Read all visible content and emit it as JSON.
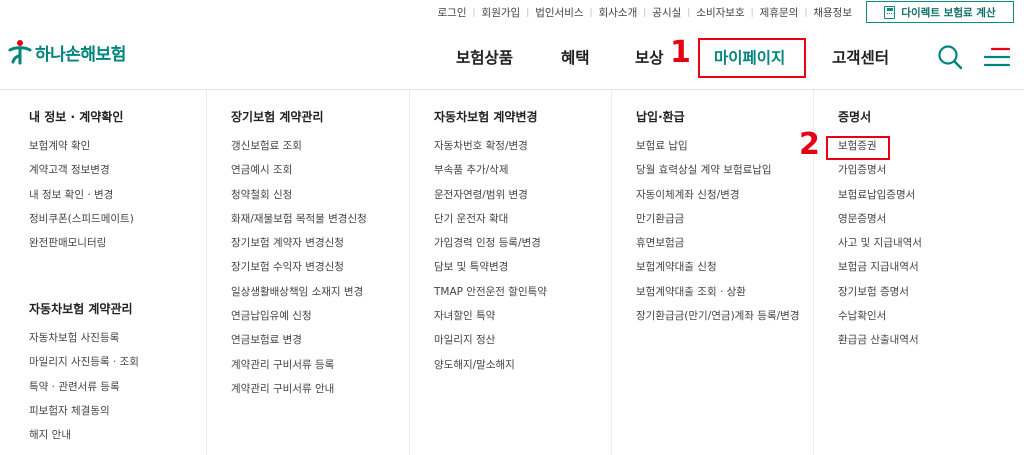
{
  "utility": {
    "links": [
      "로그인",
      "회원가입",
      "법인서비스",
      "회사소개",
      "공시실",
      "소비자보호",
      "제휴문의",
      "채용정보"
    ],
    "calc_button": "다이렉트 보험료 계산"
  },
  "brand": {
    "name": "하나손해보험",
    "color": "#00857b"
  },
  "gnb": {
    "items": [
      "보험상품",
      "혜택",
      "보상",
      "마이페이지",
      "고객센터"
    ],
    "active": "마이페이지"
  },
  "annotations": {
    "marker_1": "1",
    "marker_2": "2"
  },
  "menu": {
    "col1": {
      "group1": {
        "title": "내 정보 · 계약확인",
        "items": [
          "보험계약 확인",
          "계약고객 정보변경",
          "내 정보 확인 · 변경",
          "정비쿠폰(스피드메이트)",
          "완전판매모니터링"
        ]
      },
      "group2": {
        "title": "자동차보험 계약관리",
        "items": [
          "자동차보험 사진등록",
          "마일리지 사진등록 · 조회",
          "특약 · 관련서류 등록",
          "피보험자 체결동의",
          "해지 안내"
        ]
      }
    },
    "col2": {
      "title": "장기보험 계약관리",
      "items": [
        "갱신보험료 조회",
        "연금예시 조회",
        "청약철회 신청",
        "화재/재물보험 목적물 변경신청",
        "장기보험 계약자 변경신청",
        "장기보험 수익자 변경신청",
        "일상생활배상책임 소재지 변경",
        "연금납입유예 신청",
        "연금보험료 변경",
        "계약관리 구비서류 등록",
        "계약관리 구비서류 안내"
      ]
    },
    "col3": {
      "title": "자동차보험 계약변경",
      "items": [
        "자동차번호 확정/변경",
        "부속품 추가/삭제",
        "운전자연령/범위 변경",
        "단기 운전자 확대",
        "가입경력 인정 등록/변경",
        "담보 및 특약변경",
        "TMAP 안전운전 할인특약",
        "자녀할인 특약",
        "마일리지 정산",
        "양도해지/말소해지"
      ]
    },
    "col4": {
      "title": "납입·환급",
      "items": [
        "보험료 납입",
        "당월 효력상실 계약 보험료납입",
        "자동이체계좌 신청/변경",
        "만기환급금",
        "휴면보험금",
        "보험계약대출 신청",
        "보험계약대출 조회 · 상환",
        "장기환급금(만기/연금)계좌 등록/변경"
      ]
    },
    "col5": {
      "title": "증명서",
      "items": [
        "보험증권",
        "가입증명서",
        "보험료납입증명서",
        "영문증명서",
        "사고 및 지급내역서",
        "보험금 지급내역서",
        "장기보험 증명서",
        "수납확인서",
        "환급금 산출내역서"
      ]
    }
  }
}
